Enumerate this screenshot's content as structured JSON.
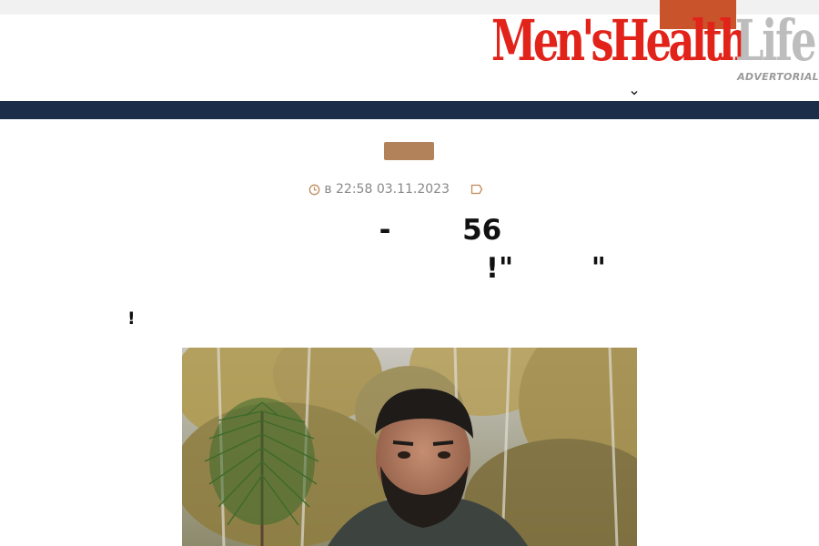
{
  "topbar": {
    "cta_label": "ᅟᅟᅟ ᅟᅟᅟ",
    "link_label": "ᅟᅟᅟᅟ ᅟᅟ ᅟᅟᅟᅟ"
  },
  "logo": {
    "mens_health": "Men'sHealth",
    "life": "Life",
    "advertorial": "ADVERTORIAL"
  },
  "nav": {
    "items": [
      {
        "label": "ᅟᅟ",
        "icon": "chevron-down-icon"
      },
      {
        "label": "ᅟᅟᅟᅟ"
      },
      {
        "label": "ᅟᅟ"
      },
      {
        "label": "ᅟᅟ"
      }
    ]
  },
  "article": {
    "category": "ᅟᅟᅟ ᅟᅟ",
    "datetime": "в 22:58 03.11.2023",
    "author": "ᅟᅟ",
    "title": "ᅟᅟ ᅟ ᅟᅟᅟ ᅟᅟ - ᅟᅟ 56 ᅟᅟ ᅟ ᅟᅟᅟ ᅟᅟᅟ ᅟ ᅟᅟᅟ ᅟᅟ !\"ᅟᅟᅟ\"",
    "subtitle": "!ᅟᅟ ᅟᅟ ᅟᅟ ᅟᅟ ᅟᅟᅟ ᅟᅟ ᅟᅟᅟ ᅟᅟ ᅟᅟᅟ ᅟᅟᅟᅟ ᅟᅟᅟ ᅟᅟ ᅟᅟ ᅟᅟᅟ ᅟᅟ ᅟᅟ"
  },
  "colors": {
    "logo_red": "#e2231a",
    "logo_gray": "#bdbdbd",
    "nav_band": "#1c2d4a",
    "cta_bg": "#c9532b",
    "category_bg": "#b2825a"
  }
}
